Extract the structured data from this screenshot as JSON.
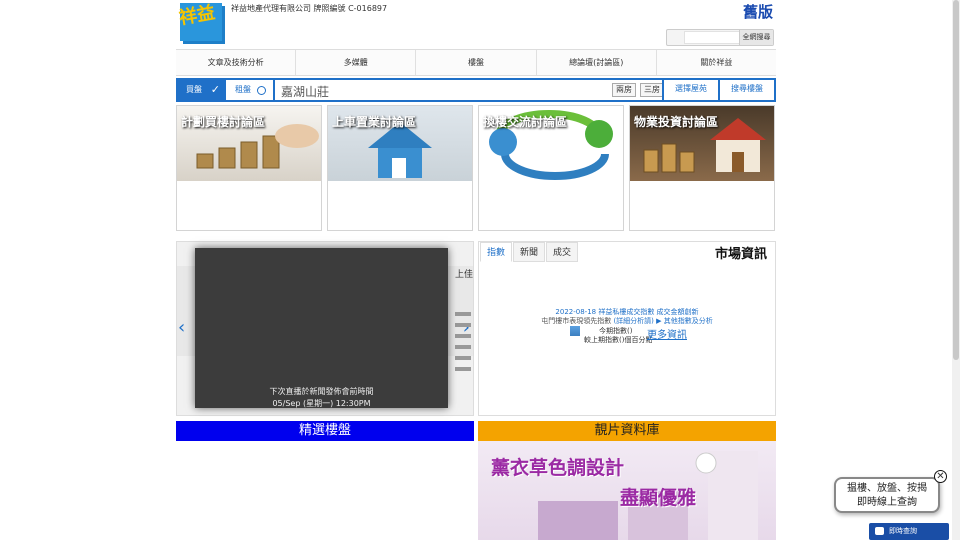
{
  "header": {
    "logo_text": "祥益",
    "company": "祥益地產代理有限公司 牌照編號 C-016897",
    "old_version": "舊版",
    "site_search_button": "全網搜尋"
  },
  "nav": {
    "items": [
      {
        "label": "文章及技術分析"
      },
      {
        "label": "多媒體"
      },
      {
        "label": "樓盤"
      },
      {
        "label": "總論壇(討論區)"
      },
      {
        "label": "關於祥益"
      }
    ]
  },
  "search": {
    "buy_label": "買盤",
    "rent_label": "租盤",
    "estate_value": "嘉湖山莊",
    "room2": "兩房",
    "room3": "三房",
    "select_estate": "選擇屋苑",
    "search_listing": "搜尋樓盤"
  },
  "forums": [
    {
      "title": "計劃買樓討論區"
    },
    {
      "title": "上車置業討論區"
    },
    {
      "title": "換樓交流討論區"
    },
    {
      "title": "物業投資討論區"
    }
  ],
  "slideshow": {
    "prev": "‹",
    "next": "›",
    "peek_title": "上佳",
    "video_line1": "下次直播於新聞發佈會前時間",
    "video_line2": "05/Sep (星期一) 12:30PM"
  },
  "market": {
    "title": "市場資訊",
    "tabs": [
      {
        "label": "指數",
        "active": true
      },
      {
        "label": "新聞",
        "active": false
      },
      {
        "label": "成交",
        "active": false
      }
    ],
    "headline": "2022-08-18 祥益私樓成交指數 成交金額創新",
    "sub_plain": "屯門樓市表現領先指數",
    "sub_link1": "(詳細分析請)",
    "sub_link2": "▶ 其他指數及分析",
    "index_line1": "今期指數()",
    "index_line2": "較上期指數()個百分點",
    "more": "更多資訊"
  },
  "featured": {
    "title": "精選樓盤"
  },
  "gallery": {
    "title": "靚片資料庫",
    "headline": "薰衣草色調設計",
    "subline": "盡顯優雅"
  },
  "floating": {
    "bubble_line1": "揾樓、放盤、按揭",
    "bubble_line2": "即時線上查詢",
    "close": "✕",
    "chat_button": "即時查詢"
  }
}
